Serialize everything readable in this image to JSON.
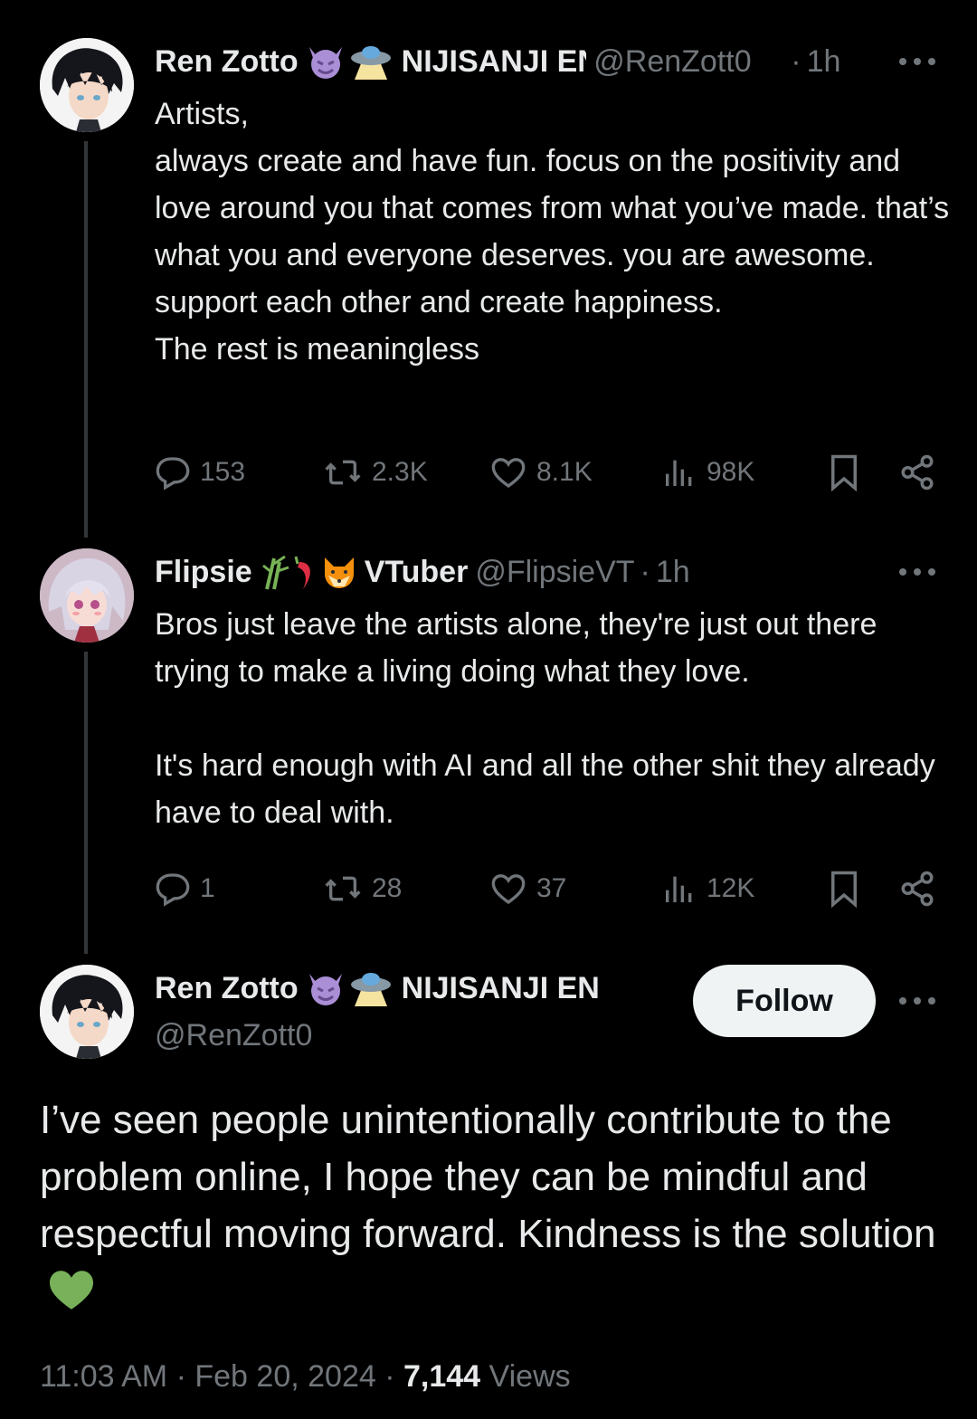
{
  "thread": [
    {
      "name": "Ren Zotto",
      "badge": "NIJISANJI E",
      "handle": "@RenZott0",
      "time": "1h",
      "text": "Artists,\nalways create and have fun. focus on the positivity and love around you that comes from what you’ve made. that’s what you and everyone deserves. you are awesome. support each other and create happiness.\nThe rest is meaningless",
      "stats": {
        "replies": "153",
        "reposts": "2.3K",
        "likes": "8.1K",
        "views": "98K"
      }
    },
    {
      "name": "Flipsie",
      "badge": "VTuber",
      "handle": "@FlipsieVT",
      "time": "1h",
      "text": "Bros just leave the artists alone, they're just out there trying to make a living doing what they love.\n\nIt's hard enough with AI and all the other shit they already have to deal with.",
      "stats": {
        "replies": "1",
        "reposts": "28",
        "likes": "37",
        "views": "12K"
      }
    }
  ],
  "main": {
    "name": "Ren Zotto",
    "badge": "NIJISANJI EN",
    "handle": "@RenZott0",
    "follow_label": "Follow",
    "text": "I’ve seen people unintentionally contribute to the problem online, I hope they can be mindful and respectful moving forward. Kindness is the solution",
    "time": "11:03 AM",
    "date": "Feb 20, 2024",
    "views_count": "7,144",
    "views_label": "Views"
  },
  "icons": [
    "devil-emoji-icon",
    "ufo-emoji-icon",
    "bamboo-emoji-icon",
    "chili-emoji-icon",
    "fox-emoji-icon",
    "green-heart-emoji-icon",
    "reply-icon",
    "repost-icon",
    "like-icon",
    "views-icon",
    "bookmark-icon",
    "share-icon",
    "more-icon"
  ],
  "colors": {
    "background": "#000000",
    "text": "#e7e9ea",
    "muted": "#71767b",
    "follow_bg": "#eff3f4",
    "green_heart": "#78b159",
    "devil": "#aa8ed6"
  }
}
